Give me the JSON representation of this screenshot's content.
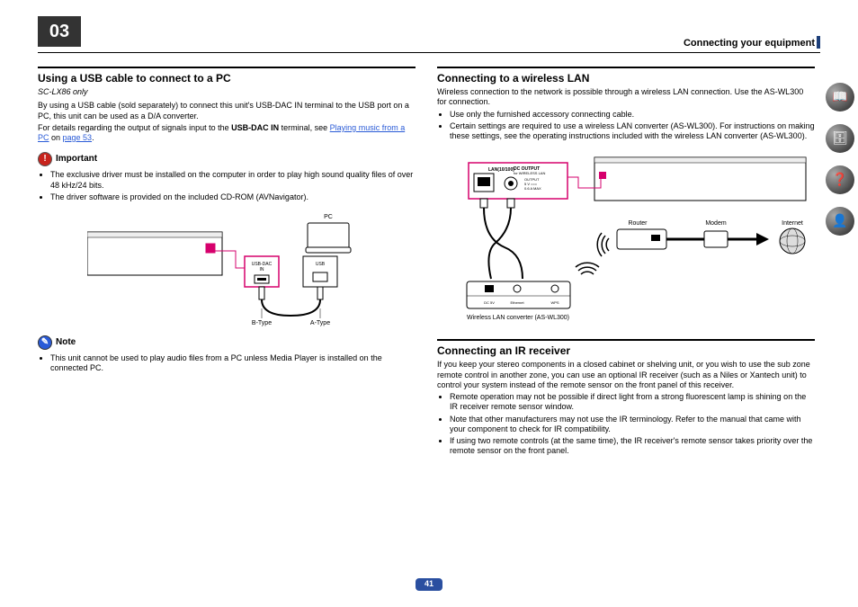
{
  "chapter": {
    "number": "03",
    "title": "Connecting your equipment",
    "page_number": "41"
  },
  "left": {
    "heading": "Using a USB cable to connect to a PC",
    "model": "SC-LX86 only",
    "body": "By using a USB cable (sold separately) to connect this unit's USB-DAC IN terminal to the USB port on a PC, this unit can be used as a D/A converter.",
    "body_cont_pre": "For details regarding the output of signals input to the ",
    "body_cont_bold": "USB-DAC IN",
    "body_cont_mid": " terminal, see ",
    "link_text": "Playing music from a PC",
    "body_cont_post": " on ",
    "page_link": "page 53",
    "body_period": ".",
    "important_label": "Important",
    "important_items": [
      "The exclusive driver must be installed on the computer in order to play high sound quality files of over 48 kHz/24 bits.",
      "The driver software is provided on the included CD-ROM (AVNavigator)."
    ],
    "diagram": {
      "pc_label": "PC",
      "port_box1_line1": "USB-DAC",
      "port_box1_line2": "IN",
      "port_box2": "USB",
      "btype": "B-Type",
      "atype": "A-Type"
    },
    "note_label": "Note",
    "note_items": [
      "This unit cannot be used to play audio files from a PC unless Media Player is installed on the connected PC."
    ]
  },
  "right": {
    "heading1": "Connecting to a wireless LAN",
    "body1": "Wireless connection to the network is possible through a wireless LAN connection. Use the AS-WL300 for connection.",
    "bullets1": [
      "Use only the furnished accessory connecting cable.",
      "Certain settings are required to use a wireless LAN converter (AS-WL300). For instructions on making these settings, see the operating instructions included with the wireless LAN converter (AS-WL300)."
    ],
    "diagram": {
      "lan_label": "LAN(10/100)",
      "dc_top": "DC OUTPUT",
      "dc_sub": "for WIRELESS LAN",
      "dc_lines": "OUTPUT\n5 V\n0.6 A MAX",
      "router": "Router",
      "modem": "Modem",
      "internet": "Internet",
      "converter_caption": "Wireless LAN converter (AS-WL300)",
      "wps": "WPS",
      "dc5v": "DC 5V",
      "eth": "Ethernet"
    },
    "heading2": "Connecting an IR receiver",
    "body2": "If you keep your stereo components in a closed cabinet or shelving unit, or you wish to use the sub zone remote control in another zone, you can use an optional IR receiver (such as a Niles or Xantech unit) to control your system instead of the remote sensor on the front panel of this receiver.",
    "bullets2": [
      "Remote operation may not be possible if direct light from a strong fluorescent lamp is shining on the IR receiver remote sensor window.",
      "Note that other manufacturers may not use the IR terminology. Refer to the manual that came with your component to check for IR compatibility.",
      "If using two remote controls (at the same time), the IR receiver's remote sensor takes priority over the remote sensor on the front panel."
    ]
  },
  "side_icons": [
    "book-icon",
    "stack-icon",
    "question-icon",
    "person-icon"
  ]
}
